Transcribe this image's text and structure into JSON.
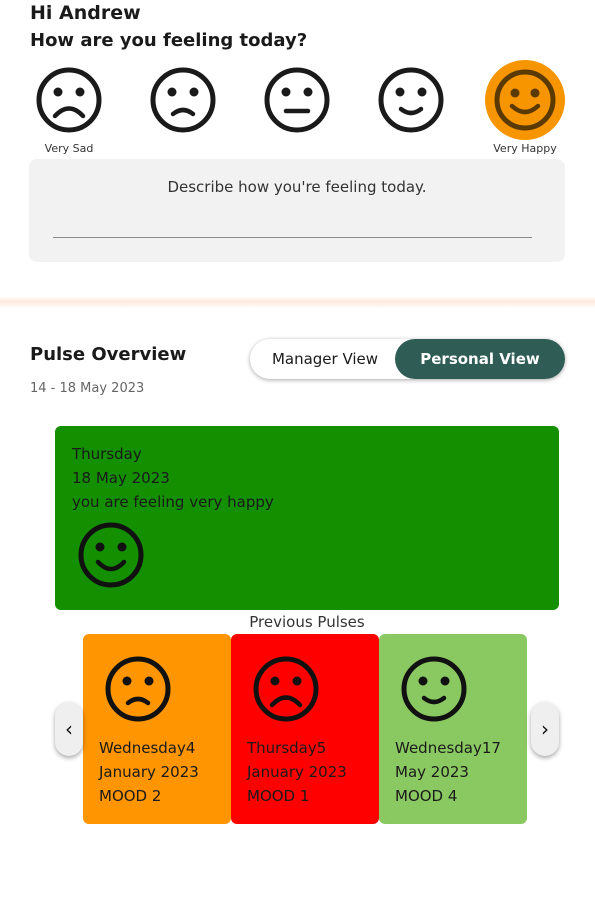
{
  "header": {
    "greeting": "Hi Andrew",
    "question": "How are you feeling today?"
  },
  "mood_picker": {
    "options": [
      {
        "name": "very-sad-icon",
        "label": "Very Sad",
        "selected": false
      },
      {
        "name": "sad-icon",
        "label": "",
        "selected": false
      },
      {
        "name": "neutral-icon",
        "label": "",
        "selected": false
      },
      {
        "name": "happy-icon",
        "label": "",
        "selected": false
      },
      {
        "name": "very-happy-icon",
        "label": "Very Happy",
        "selected": true
      }
    ],
    "selected_color": "#f79500"
  },
  "describe": {
    "prompt": "Describe how you're feeling today."
  },
  "pulse": {
    "title": "Pulse Overview",
    "date_range": "14 - 18 May 2023",
    "view_toggle": {
      "manager_label": "Manager View",
      "personal_label": "Personal View",
      "active": "personal"
    },
    "current": {
      "day": "Thursday",
      "date": "18 May 2023",
      "message": "you are feeling very happy",
      "color": "#138f00"
    },
    "previous_title": "Previous Pulses",
    "previous": [
      {
        "line1": "Wednesday4",
        "line2": "January 2023",
        "mood": "MOOD 2",
        "color": "#ff9500",
        "face": "sad-icon"
      },
      {
        "line1": "Thursday5",
        "line2": "January 2023",
        "mood": "MOOD 1",
        "color": "#ff0000",
        "face": "very-sad-icon"
      },
      {
        "line1": "Wednesday17",
        "line2": "May 2023",
        "mood": "MOOD 4",
        "color": "#8ac962",
        "face": "happy-icon"
      }
    ],
    "nav": {
      "prev_icon": "‹",
      "next_icon": "›"
    }
  }
}
